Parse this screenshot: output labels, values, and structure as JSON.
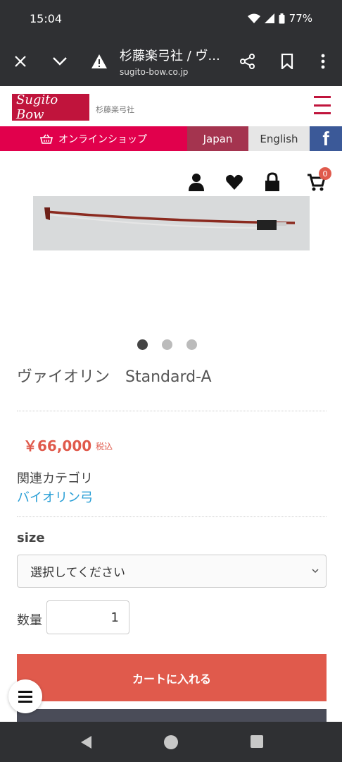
{
  "status": {
    "time": "15:04",
    "battery": "77%"
  },
  "browser": {
    "title": "杉藤楽弓社 / ヴ...",
    "url": "sugito-bow.co.jp"
  },
  "site": {
    "logo_text": "Sugito Bow",
    "logo_sub": "杉藤楽弓社",
    "brand_color": "#c0143c"
  },
  "nav": {
    "shop": "オンラインショップ",
    "japan": "Japan",
    "english": "English",
    "facebook": "f"
  },
  "user": {
    "cart_count": "0"
  },
  "product": {
    "name": "ヴァイオリン　Standard-A",
    "price": "￥66,000",
    "tax": "税込",
    "category_label": "関連カテゴリ",
    "category_link": "バイオリン弓",
    "size_label": "size",
    "size_select": "選択してください",
    "qty_label": "数量",
    "qty_value": "1",
    "cart_button": "カートに入れる",
    "slides_total": 3,
    "slide_active": 1
  }
}
